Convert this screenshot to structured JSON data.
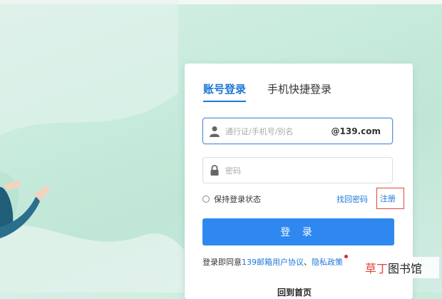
{
  "tabs": [
    {
      "label": "账号登录",
      "active": true
    },
    {
      "label": "手机快捷登录",
      "active": false
    }
  ],
  "account_field": {
    "placeholder": "通行证/手机号/别名",
    "suffix": "@139.com",
    "icon": "user-icon"
  },
  "password_field": {
    "placeholder": "密码",
    "icon": "lock-icon"
  },
  "options": {
    "keep_login": "保持登录状态",
    "forgot": "找回密码",
    "register": "注册"
  },
  "login_button": "登 录",
  "agreement": {
    "prefix": "登录即同意",
    "link1": "139邮箱用户协议",
    "separator": "、",
    "link2": "隐私政策"
  },
  "qr_label": "回到首页",
  "watermark": {
    "part1": "草丁",
    "part2": "图书馆"
  },
  "colors": {
    "accent": "#1d78d6",
    "button": "#2e88f0",
    "highlight_box": "#e0463c"
  }
}
